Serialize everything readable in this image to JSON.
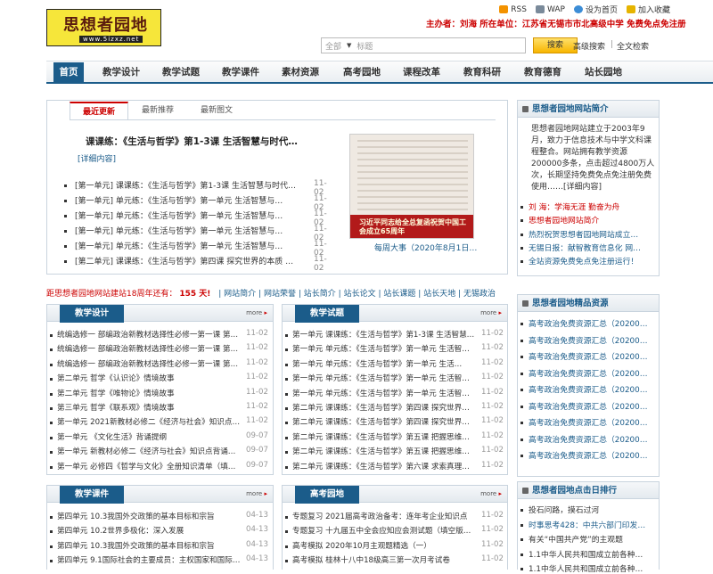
{
  "header": {
    "logo_title": "思想者园地",
    "logo_url": "www.5izxz.net",
    "toplinks": [
      {
        "label": "RSS",
        "icon": "rss-icon"
      },
      {
        "label": "WAP",
        "icon": "phone-icon"
      },
      {
        "label": "设为首页",
        "icon": "home-icon"
      },
      {
        "label": "加入收藏",
        "icon": "star-icon"
      }
    ],
    "hostline": "主办者：刘海  所在单位：江苏省无锡市市北高级中学  免费免点免注册",
    "search": {
      "scope": "全部",
      "placeholder": "标题",
      "button": "搜索",
      "advanced": "高级搜索",
      "fulltext": "全文检索"
    }
  },
  "nav": [
    "首页",
    "教学设计",
    "教学试题",
    "教学课件",
    "素材资源",
    "高考园地",
    "课程改革",
    "教育科研",
    "教育德育",
    "站长园地"
  ],
  "latest": {
    "tabs": [
      "最近更新",
      "最新推荐",
      "最新图文"
    ],
    "headline": "课课练：《生活与哲学》第1-3课  生活智慧与时代…",
    "detail": "[详细内容]",
    "items": [
      {
        "text": "[第一单元] 课课练：《生活与哲学》第1-3课  生活智慧与时代…",
        "date": "11-02"
      },
      {
        "text": "[第一单元] 单元练：《生活与哲学》第一单元  生活智慧与…",
        "date": "11-02"
      },
      {
        "text": "[第一单元] 单元练：《生活与哲学》第一单元  生活智慧与…",
        "date": "11-02"
      },
      {
        "text": "[第一单元] 单元练：《生活与哲学》第一单元  生活智慧与…",
        "date": "11-02"
      },
      {
        "text": "[第一单元] 单元练：《生活与哲学》第一单元  生活智慧与…",
        "date": "11-02"
      },
      {
        "text": "[第二单元] 课课练：《生活与哲学》第四课  探究世界的本质 …",
        "date": "11-02"
      }
    ],
    "image_text": "习近平同志给全总复函祝贺中国工会成立65周年",
    "image_caption": "每周大事（2020年8月1日…"
  },
  "ticker": {
    "prefix": "距思想者园地网站建站18周年还有：",
    "days": "155 天!",
    "links": [
      "网站简介",
      "网站荣誉",
      "站长简介",
      "站长论文",
      "站长课题",
      "站长天地",
      "无锡政治"
    ]
  },
  "sections": {
    "design": {
      "title": "教学设计",
      "more": "more",
      "items": [
        {
          "text": "统编选修一  部编政治新教材选择性必修一第一课  第二…",
          "date": "11-02"
        },
        {
          "text": "统编选修一  部编政治新教材选择性必修一第一课  第二…",
          "date": "11-02"
        },
        {
          "text": "统编选修一  部编政治新教材选择性必修一第一课  第二…",
          "date": "11-02"
        },
        {
          "text": "第二单元  哲学《认识论》情境故事",
          "date": "11-02"
        },
        {
          "text": "第二单元  哲学《唯物论》情境故事",
          "date": "11-02"
        },
        {
          "text": "第三单元  哲学《联系观》情境故事",
          "date": "11-02"
        },
        {
          "text": "第一单元  2021新教材必修二《经济与社会》知识点背…",
          "date": "11-02"
        },
        {
          "text": "第一单元  《文化生活》背诵提纲",
          "date": "09-07"
        },
        {
          "text": "第一单元  新教材必修二《经济与社会》知识点背诵提纲",
          "date": "09-07"
        },
        {
          "text": "第一单元  必修四《哲学与文化》全册知识清单（填空…",
          "date": "09-07"
        }
      ]
    },
    "tests": {
      "title": "教学试题",
      "more": "more",
      "items": [
        {
          "text": "第一单元  课课练：《生活与哲学》第1-3课  生活智慧…",
          "date": "11-02"
        },
        {
          "text": "第一单元  单元练：《生活与哲学》第一单元  生活智慧…",
          "date": "11-02"
        },
        {
          "text": "第一单元  单元练：《生活与哲学》第一单元  生活…",
          "date": "11-02"
        },
        {
          "text": "第一单元  单元练：《生活与哲学》第一单元  生活智慧…",
          "date": "11-02"
        },
        {
          "text": "第一单元  单元练：《生活与哲学》第一单元  生活智慧…",
          "date": "11-02"
        },
        {
          "text": "第二单元  课课练：《生活与哲学》第四课  探究世界…",
          "date": "11-02"
        },
        {
          "text": "第二单元  课课练：《生活与哲学》第四课  探究世界…",
          "date": "11-02"
        },
        {
          "text": "第二单元  课课练：《生活与哲学》第五课  把握思维…",
          "date": "11-02"
        },
        {
          "text": "第二单元  课课练：《生活与哲学》第五课  把握思维…",
          "date": "11-02"
        },
        {
          "text": "第二单元  课课练：《生活与哲学》第六课  求索真理…",
          "date": "11-02"
        }
      ]
    },
    "courseware": {
      "title": "教学课件",
      "more": "more",
      "items": [
        {
          "text": "第四单元  10.3我国外交政策的基本目标和宗旨",
          "date": "04-13"
        },
        {
          "text": "第四单元  10.2世界多极化：深入发展",
          "date": "04-13"
        },
        {
          "text": "第四单元  10.3我国外交政策的基本目标和宗旨",
          "date": "04-13"
        },
        {
          "text": "第四单元  9.1国际社会的主要成员：主权国家和国际…",
          "date": "04-13"
        }
      ]
    },
    "gaokao": {
      "title": "高考园地",
      "more": "more",
      "items": [
        {
          "text": "专题复习  2021届高考政治备考：连年考企业知识点",
          "date": "11-02"
        },
        {
          "text": "专题复习  十九届五中全会应知应会测试题（填空版…",
          "date": "11-02"
        },
        {
          "text": "高考模拟  2020年10月主观题精选（一）",
          "date": "11-02"
        },
        {
          "text": "高考模拟  桂林十八中18级高三第一次月考试卷",
          "date": "11-02"
        }
      ]
    }
  },
  "right": {
    "intro_title": "思想者园地网站简介",
    "intro_text": "思想者园地网站建立于2003年9月，致力于信息技术与中学文科课程整合。网站拥有教学资源200000多条，点击超过4800万人次，长期坚持免费免点免注册免费使用……[详细内容]",
    "intro_links": [
      {
        "text": "刘  海：学海无涯  勤奋为舟",
        "color": "#c00"
      },
      {
        "text": "思想者园地网站简介",
        "color": "#c00"
      },
      {
        "text": "热烈祝贺思想者园地网站成立…",
        "color": "#1b5c8a"
      },
      {
        "text": "无锡日报：献智教育信息化  网…",
        "color": "#1b5c8a"
      },
      {
        "text": "全站资源免费免点免注册运行！",
        "color": "#1b5c8a"
      }
    ],
    "quality_title": "思想者园地精品资源",
    "quality_items": [
      "高考政治免费资源汇总（20200…",
      "高考政治免费资源汇总（20200…",
      "高考政治免费资源汇总（20200…",
      "高考政治免费资源汇总（20200…",
      "高考政治免费资源汇总（20200…",
      "高考政治免费资源汇总（20200…",
      "高考政治免费资源汇总（20200…",
      "高考政治免费资源汇总（20200…",
      "高考政治免费资源汇总（20200…"
    ],
    "rank_title": "思想者园地点击日排行",
    "rank_items": [
      {
        "text": "投石问路，摸石过河",
        "color": "#333"
      },
      {
        "text": "时事思考428：中共六部门印发…",
        "color": "#1b5c8a"
      },
      {
        "text": "有关“中国共产党”的主观题",
        "color": "#333"
      },
      {
        "text": "1.1中华人民共和国成立前各种…",
        "color": "#333"
      },
      {
        "text": "1.1中华人民共和国成立前各种…",
        "color": "#333"
      }
    ]
  }
}
